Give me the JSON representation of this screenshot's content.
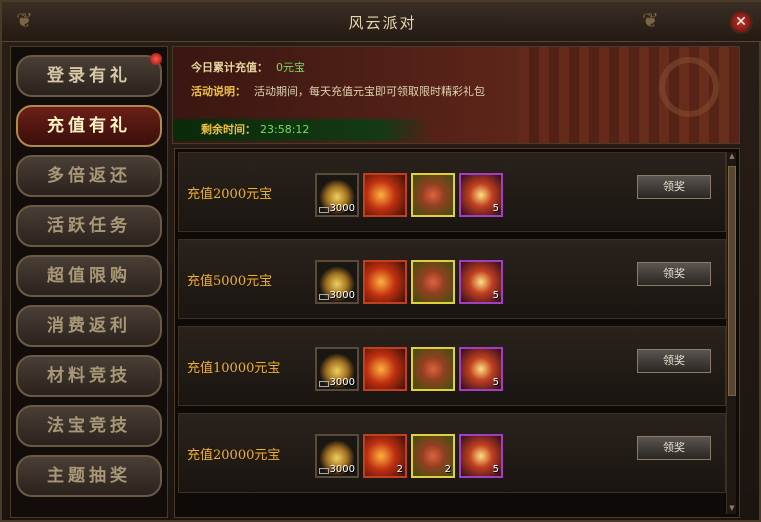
{
  "window": {
    "title": "风云派对"
  },
  "sidebar": {
    "items": [
      {
        "label": "登录有礼"
      },
      {
        "label": "充值有礼"
      },
      {
        "label": "多倍返还"
      },
      {
        "label": "活跃任务"
      },
      {
        "label": "超值限购"
      },
      {
        "label": "消费返利"
      },
      {
        "label": "材料竞技"
      },
      {
        "label": "法宝竞技"
      },
      {
        "label": "主题抽奖"
      }
    ]
  },
  "banner": {
    "today_label": "今日累计充值：",
    "today_value": "0元宝",
    "desc_label": "活动说明：",
    "desc_text": "活动期间，每天充值元宝即可领取限时精彩礼包",
    "remain_label": "剩余时间：",
    "remain_value": "23:58:12"
  },
  "rows": [
    {
      "label": "充值2000元宝",
      "counts": [
        "3000",
        "",
        "",
        "5"
      ],
      "button": "领奖"
    },
    {
      "label": "充值5000元宝",
      "counts": [
        "3000",
        "",
        "",
        "5"
      ],
      "button": "领奖"
    },
    {
      "label": "充值10000元宝",
      "counts": [
        "3000",
        "",
        "",
        "5"
      ],
      "button": "领奖"
    },
    {
      "label": "充值20000元宝",
      "counts": [
        "3000",
        "2",
        "2",
        "5"
      ],
      "button": "领奖"
    }
  ],
  "colors": {
    "accent_gold": "#f0b030",
    "green": "#6fe060",
    "active_red": "#6a2018"
  }
}
